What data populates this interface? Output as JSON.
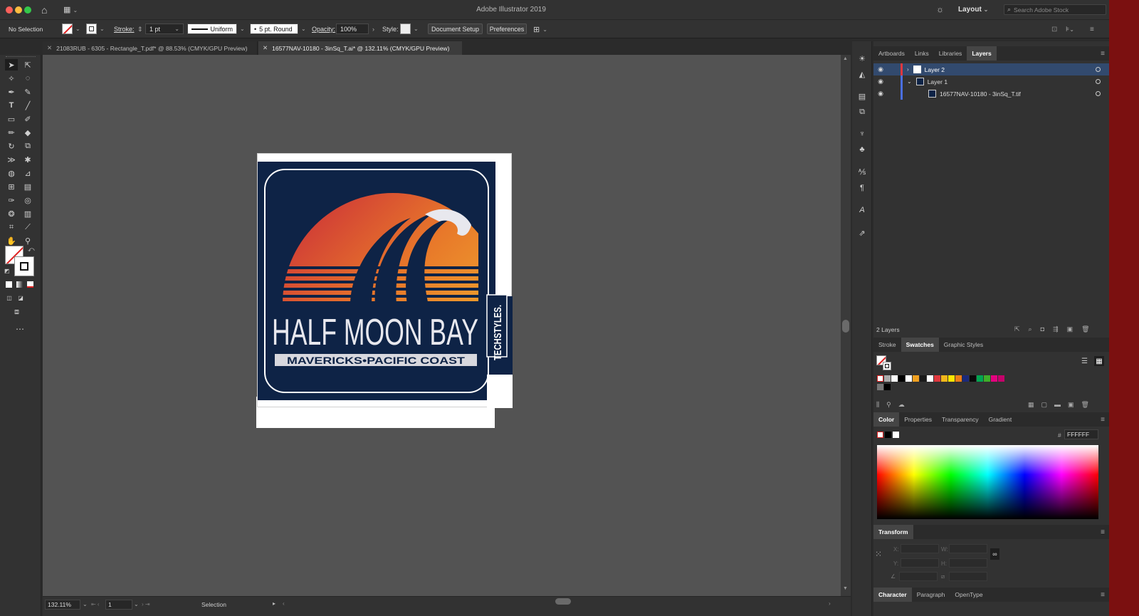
{
  "app": {
    "title": "Adobe Illustrator 2019",
    "workspace": "Layout",
    "search_placeholder": "Search Adobe Stock"
  },
  "control_bar": {
    "selection": "No Selection",
    "stroke_label": "Stroke:",
    "stroke_weight": "1 pt",
    "stroke_profile": "Uniform",
    "brush": "5 pt. Round",
    "opacity_label": "Opacity:",
    "opacity_value": "100%",
    "style_label": "Style:",
    "document_setup": "Document Setup",
    "preferences": "Preferences"
  },
  "doc_tabs": [
    {
      "label": "21083RUB - 6305 - Rectangle_T.pdf* @ 88.53% (CMYK/GPU Preview)",
      "active": false
    },
    {
      "label": "16577NAV-10180 - 3inSq_T.ai* @ 132.11% (CMYK/GPU Preview)",
      "active": true
    }
  ],
  "artwork": {
    "title": "HALF MOON BAY",
    "subtitle": "MAVERICKS•PACIFIC COAST",
    "side_text": "TECHSTYLES.",
    "colors": {
      "navy": "#0e2346",
      "red": "#c8283a",
      "orange": "#e8782a",
      "yellow": "#f2c230"
    }
  },
  "status": {
    "zoom": "132.11%",
    "artboard": "1",
    "tool": "Selection"
  },
  "layers_panel": {
    "tabs": [
      "Artboards",
      "Links",
      "Libraries",
      "Layers"
    ],
    "active_tab": "Layers",
    "rows": [
      {
        "name": "Layer 2",
        "color": "#e0383e",
        "selected": true,
        "expanded": false
      },
      {
        "name": "Layer 1",
        "color": "#4a6fe0",
        "selected": false,
        "expanded": true
      },
      {
        "name": "16577NAV-10180 - 3inSq_T.tif",
        "color": "#4a6fe0",
        "selected": false,
        "child": true
      }
    ],
    "count": "2 Layers"
  },
  "swatches_panel": {
    "tabs": [
      "Stroke",
      "Swatches",
      "Graphic Styles"
    ],
    "active_tab": "Swatches",
    "colors": [
      "#ffffff",
      "#000000",
      "#ffffff",
      "#e0383e",
      "#f3b71a",
      "#ffe600",
      "#3fae2a",
      "#1c2a7a",
      "#ee7d17",
      "#1a1a1a",
      "#00a651",
      "#e4007f"
    ]
  },
  "color_panel": {
    "tabs": [
      "Color",
      "Properties",
      "Transparency",
      "Gradient"
    ],
    "active_tab": "Color",
    "hex_label": "#",
    "hex": "FFFFFF"
  },
  "transform_panel": {
    "title": "Transform",
    "x": "X:",
    "y": "Y:",
    "w": "W:",
    "h": "H:"
  },
  "character_panel": {
    "tabs": [
      "Character",
      "Paragraph",
      "OpenType"
    ],
    "active_tab": "Character"
  }
}
